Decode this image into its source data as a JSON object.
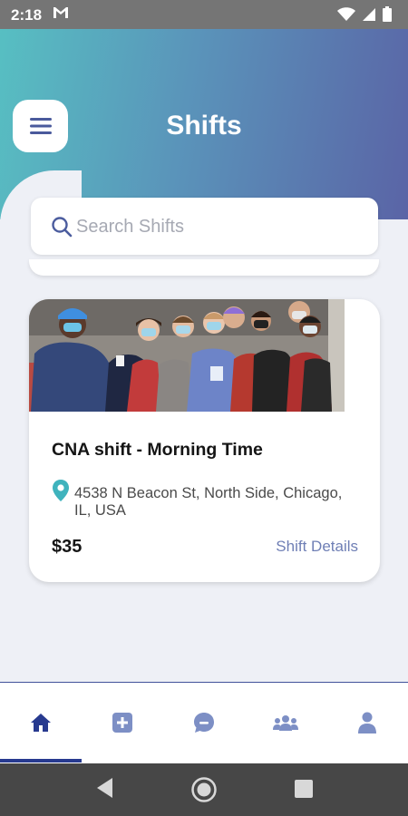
{
  "status_bar": {
    "time": "2:18",
    "mail_icon": "gmail-icon"
  },
  "header": {
    "title": "Shifts",
    "menu_icon": "hamburger-menu-icon"
  },
  "search": {
    "placeholder": "Search Shifts",
    "value": ""
  },
  "shift_card": {
    "title": "CNA shift - Morning Time",
    "address": "4538 N Beacon St, North Side, Chicago, IL, USA",
    "pay": "$35",
    "details_link": "Shift Details"
  },
  "bottom_nav": {
    "items": [
      {
        "name": "home-icon",
        "active": true
      },
      {
        "name": "add-icon",
        "active": false
      },
      {
        "name": "chat-icon",
        "active": false
      },
      {
        "name": "group-icon",
        "active": false
      },
      {
        "name": "profile-icon",
        "active": false
      }
    ]
  },
  "colors": {
    "header_start": "#57bfc2",
    "header_end": "#5a64a6",
    "accent": "#273a8f",
    "icon_muted": "#7d8fc5",
    "link": "#6f7fb5",
    "pin": "#3fb3bd"
  }
}
